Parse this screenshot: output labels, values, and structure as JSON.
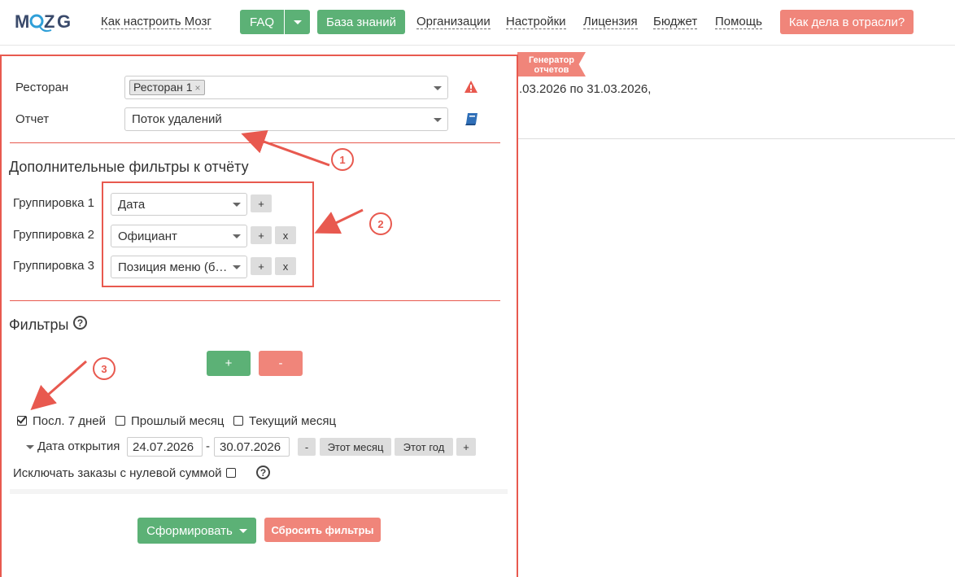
{
  "brand": {
    "logo_text": "MOZG",
    "accent": "#5cb176",
    "danger": "#f0857a",
    "annotation": "#e8594f"
  },
  "nav": {
    "how_to": "Как настроить Мозг",
    "faq": "FAQ",
    "knowledge_base": "База знаний",
    "organizations": "Организации",
    "settings": "Настройки",
    "license": "Лицензия",
    "budget": "Бюджет",
    "help": "Помощь",
    "industry": "Как дела в отрасли?"
  },
  "badge": {
    "line1": "Генератор",
    "line2": "отчетов"
  },
  "period_text": ".03.2026 по 31.03.2026,",
  "form": {
    "restaurant_label": "Ресторан",
    "restaurant_tag": "Ресторан 1",
    "restaurant_tag_remove": "×",
    "report_label": "Отчет",
    "report_value": "Поток удалений",
    "warning_icon": "warning-triangle-icon",
    "book_icon": "book-icon"
  },
  "extra_filters": {
    "title": "Дополнительные фильтры к отчёту",
    "groupings": [
      {
        "label": "Группировка 1",
        "value": "Дата",
        "add": "+",
        "remove": ""
      },
      {
        "label": "Группировка 2",
        "value": "Официант",
        "add": "+",
        "remove": "x"
      },
      {
        "label": "Группировка 3",
        "value": "Позиция меню (б…",
        "add": "+",
        "remove": "x"
      }
    ]
  },
  "filters": {
    "title": "Фильтры",
    "help": "?",
    "add": "+",
    "remove": "-",
    "presets": [
      {
        "label": "Посл. 7 дней",
        "checked": true
      },
      {
        "label": "Прошлый месяц",
        "checked": false
      },
      {
        "label": "Текущий месяц",
        "checked": false
      }
    ],
    "date_label": "Дата открытия",
    "date_from": "24.07.2026",
    "date_sep": "-",
    "date_to": "30.07.2026",
    "minus": "-",
    "this_month": "Этот месяц",
    "this_year": "Этот год",
    "plus": "+",
    "exclude_zero": "Исключать заказы с нулевой суммой",
    "exclude_zero_checked": false,
    "exclude_help": "?"
  },
  "actions": {
    "generate": "Сформировать",
    "reset": "Сбросить фильтры"
  },
  "annotations": {
    "step1": "1",
    "step2": "2",
    "step3": "3"
  }
}
